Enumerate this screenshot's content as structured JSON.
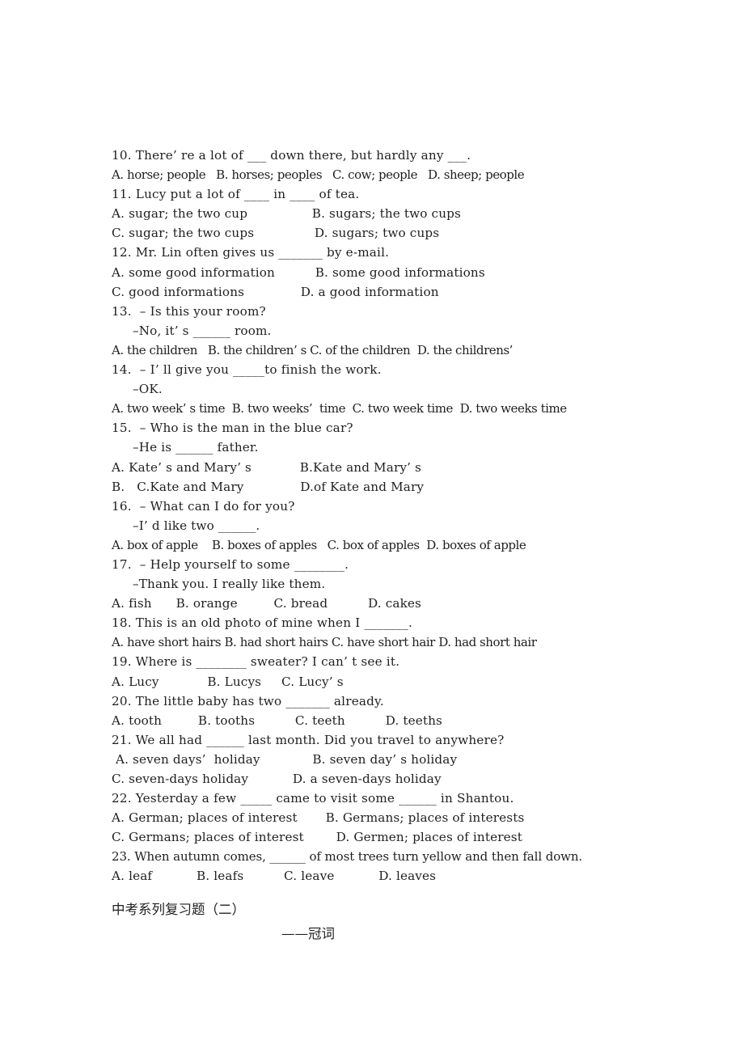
{
  "document": {
    "background_color": "#ffffff",
    "text_color": "#1f1f1f",
    "section_heading": "中考系列复习题（二）",
    "section_subheading": "——冠词"
  },
  "lines": [
    {
      "id": "q10-stem",
      "text": "10. There’ re a lot of ___ down there, but hardly any ___."
    },
    {
      "id": "q10-opts",
      "text": "A. horse; people   B. horses; peoples   C. cow; people   D. sheep; people"
    },
    {
      "id": "q11-stem",
      "text": "11. Lucy put a lot of ____ in ____ of tea."
    },
    {
      "id": "q11-optsAB",
      "text": "A. sugar; the two cup                B. sugars; the two cups"
    },
    {
      "id": "q11-optsCD",
      "text": "C. sugar; the two cups               D. sugars; two cups"
    },
    {
      "id": "q12-stem",
      "text": "12. Mr. Lin often gives us _______ by e-mail."
    },
    {
      "id": "q12-optsAB",
      "text": "A. some good information          B. some good informations"
    },
    {
      "id": "q12-optsCD",
      "text": "C. good informations              D. a good information"
    },
    {
      "id": "q13-stem",
      "text": "13.  – Is this your room?"
    },
    {
      "id": "q13-reply",
      "text": "–No, it’ s ______ room."
    },
    {
      "id": "q13-opts",
      "text": "A. the children   B. the children’ s C. of the children  D. the childrens’"
    },
    {
      "id": "q14-stem",
      "text": "14.  – I’ ll give you _____to finish the work."
    },
    {
      "id": "q14-reply",
      "text": "–OK."
    },
    {
      "id": "q14-opts",
      "text": "A. two week’ s time  B. two weeks’  time  C. two week time  D. two weeks time"
    },
    {
      "id": "q15-stem",
      "text": "15.  – Who is the man in the blue car?"
    },
    {
      "id": "q15-reply",
      "text": "–He is ______ father."
    },
    {
      "id": "q15-optsAB",
      "text": "A. Kate’ s and Mary’ s            B.Kate and Mary’ s"
    },
    {
      "id": "q15-optsCD",
      "text": "B.   C.Kate and Mary              D.of Kate and Mary"
    },
    {
      "id": "q16-stem",
      "text": "16.  – What can I do for you?"
    },
    {
      "id": "q16-reply",
      "text": "–I’ d like two ______."
    },
    {
      "id": "q16-opts",
      "text": "A. box of apple    B. boxes of apples   C. box of apples  D. boxes of apple"
    },
    {
      "id": "q17-stem",
      "text": "17.  – Help yourself to some ________."
    },
    {
      "id": "q17-reply",
      "text": "–Thank you. I really like them."
    },
    {
      "id": "q17-opts",
      "text": "A. fish      B. orange         C. bread          D. cakes"
    },
    {
      "id": "q18-stem",
      "text": "18. This is an old photo of mine when I _______."
    },
    {
      "id": "q18-opts",
      "text": "A. have short hairs B. had short hairs C. have short hair D. had short hair"
    },
    {
      "id": "q19-stem",
      "text": "19. Where is ________ sweater? I can’ t see it."
    },
    {
      "id": "q19-opts",
      "text": "A. Lucy            B. Lucys     C. Lucy’ s"
    },
    {
      "id": "q20-stem",
      "text": "20. The little baby has two _______ already."
    },
    {
      "id": "q20-opts",
      "text": "A. tooth         B. tooths          C. teeth          D. teeths"
    },
    {
      "id": "q21-stem",
      "text": "21. We all had ______ last month. Did you travel to anywhere?"
    },
    {
      "id": "q21-optsAB",
      "text": " A. seven days’  holiday             B. seven day’ s holiday"
    },
    {
      "id": "q21-optsCD",
      "text": "C. seven-days holiday           D. a seven-days holiday"
    },
    {
      "id": "q22-stem",
      "text": "22. Yesterday a few _____ came to visit some ______ in Shantou."
    },
    {
      "id": "q22-optsAB",
      "text": "A. German; places of interest       B. Germans; places of interests"
    },
    {
      "id": "q22-optsCD",
      "text": "C. Germans; places of interest        D. Germen; places of interest"
    },
    {
      "id": "q23-stem",
      "text": "23. When autumn comes, ______ of most trees turn yellow and then fall down."
    },
    {
      "id": "q23-opts",
      "text": "A. leaf           B. leafs          C. leave           D. leaves"
    }
  ],
  "line_styles": {
    "q10-stem": "stem",
    "q10-opts": "tight",
    "q11-stem": "stem",
    "q11-optsAB": "",
    "q11-optsCD": "",
    "q12-stem": "stem",
    "q12-optsAB": "",
    "q12-optsCD": "",
    "q13-stem": "stem",
    "q13-reply": "indent",
    "q13-opts": "tight",
    "q14-stem": "stem",
    "q14-reply": "indent",
    "q14-opts": "tight",
    "q15-stem": "stem",
    "q15-reply": "indent",
    "q15-optsAB": "",
    "q15-optsCD": "",
    "q16-stem": "stem",
    "q16-reply": "indent",
    "q16-opts": "tight",
    "q17-stem": "stem",
    "q17-reply": "indent",
    "q17-opts": "",
    "q18-stem": "stem",
    "q18-opts": "tight",
    "q19-stem": "stem",
    "q19-opts": "",
    "q20-stem": "stem",
    "q20-opts": "",
    "q21-stem": "stem",
    "q21-optsAB": "",
    "q21-optsCD": "",
    "q22-stem": "stem",
    "q22-optsAB": "",
    "q22-optsCD": "",
    "q23-stem": "wide",
    "q23-opts": ""
  }
}
